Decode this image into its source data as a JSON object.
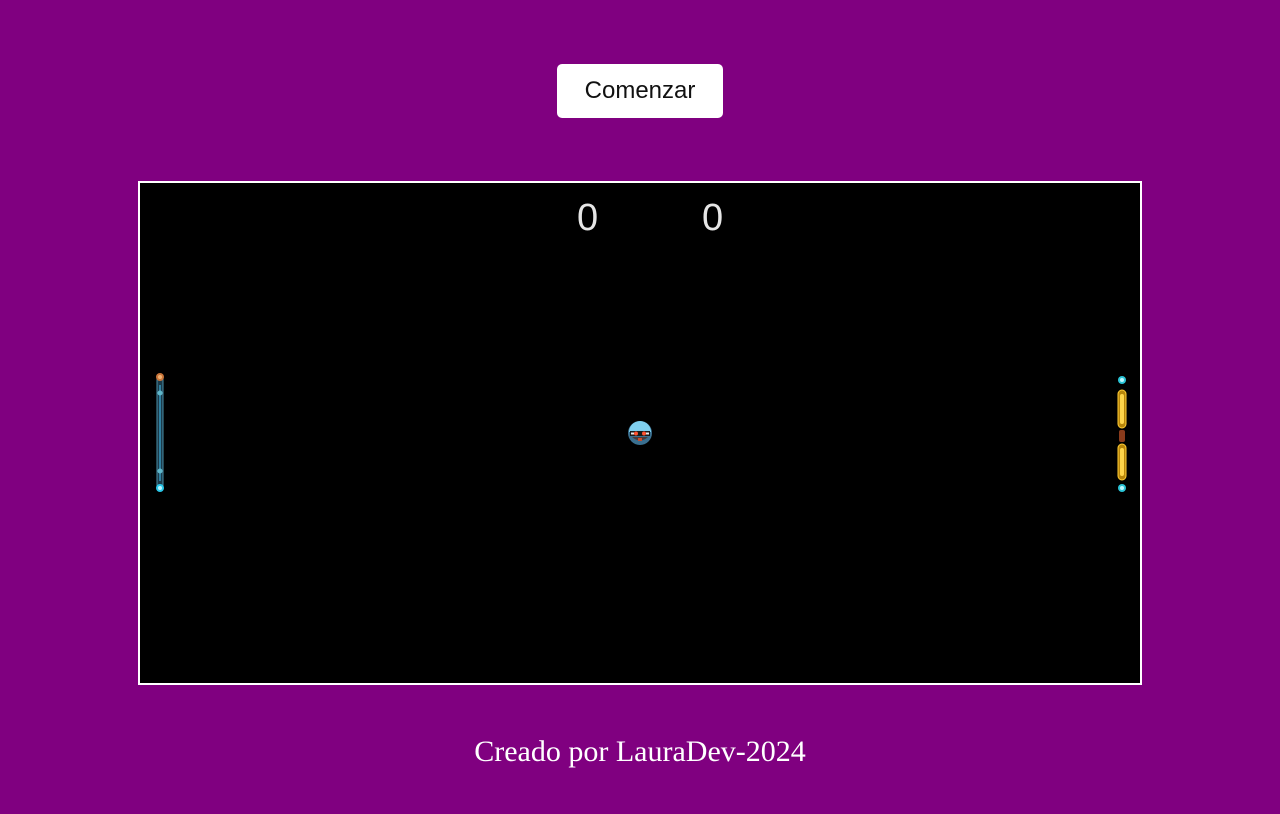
{
  "controls": {
    "start_label": "Comenzar"
  },
  "game": {
    "score_left": "0",
    "score_right": "0",
    "left_paddle_icon": "blue-orange-paddle-icon",
    "right_paddle_icon": "gold-cyan-paddle-icon",
    "ball_icon": "robot-ball-icon"
  },
  "footer": {
    "credit": "Creado por LauraDev-2024"
  },
  "colors": {
    "background": "#800080",
    "board": "#000000",
    "board_border": "#ffffff",
    "score": "#e6e6e6"
  }
}
